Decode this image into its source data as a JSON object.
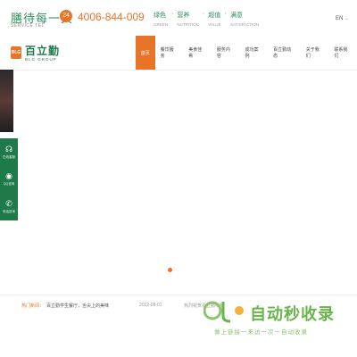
{
  "header": {
    "slogan": "膳待每一天",
    "slogan_sub": "SERVICE TEL",
    "phone_icon_text": "24",
    "phone": "4006-844-009",
    "values": [
      {
        "zh": "绿色",
        "en": "GREEN"
      },
      {
        "zh": "营养",
        "en": "NUTRITION"
      },
      {
        "zh": "超值",
        "en": "VALUE"
      },
      {
        "zh": "满意",
        "en": "SATISFACTION"
      }
    ],
    "value_sep": "·",
    "lang": "EN",
    "lang_caret": "⌄"
  },
  "logo": {
    "mark": "BLG",
    "zh": "百立勤",
    "en": "BLG GROUP"
  },
  "nav": {
    "items": [
      {
        "label": "首页"
      },
      {
        "label": "餐饮服务"
      },
      {
        "label": "美食佳肴"
      },
      {
        "label": "服务内容"
      },
      {
        "label": "成功案例"
      },
      {
        "label": "百立勤动态"
      },
      {
        "label": "关于我们"
      },
      {
        "label": "联系我们"
      }
    ]
  },
  "side_tools": [
    {
      "icon": "headset-icon",
      "glyph": "☊",
      "label": "在线客服"
    },
    {
      "icon": "qq-icon",
      "glyph": "◉",
      "label": "QQ咨询"
    },
    {
      "icon": "phone-icon",
      "glyph": "✆",
      "label": "电话咨询"
    }
  ],
  "news": {
    "tag": "热门新闻：",
    "title": "百立勤学生餐厅，舌尖上的美味",
    "date": "2022-08-01",
    "title2": "热烈祝贺百立勤中标"
  },
  "watermark": {
    "text": "自动秒收录",
    "sub": "做上链接一来访一次一自动收录"
  },
  "colors": {
    "accent": "#e8742a",
    "brand_green": "#1f7a49"
  }
}
